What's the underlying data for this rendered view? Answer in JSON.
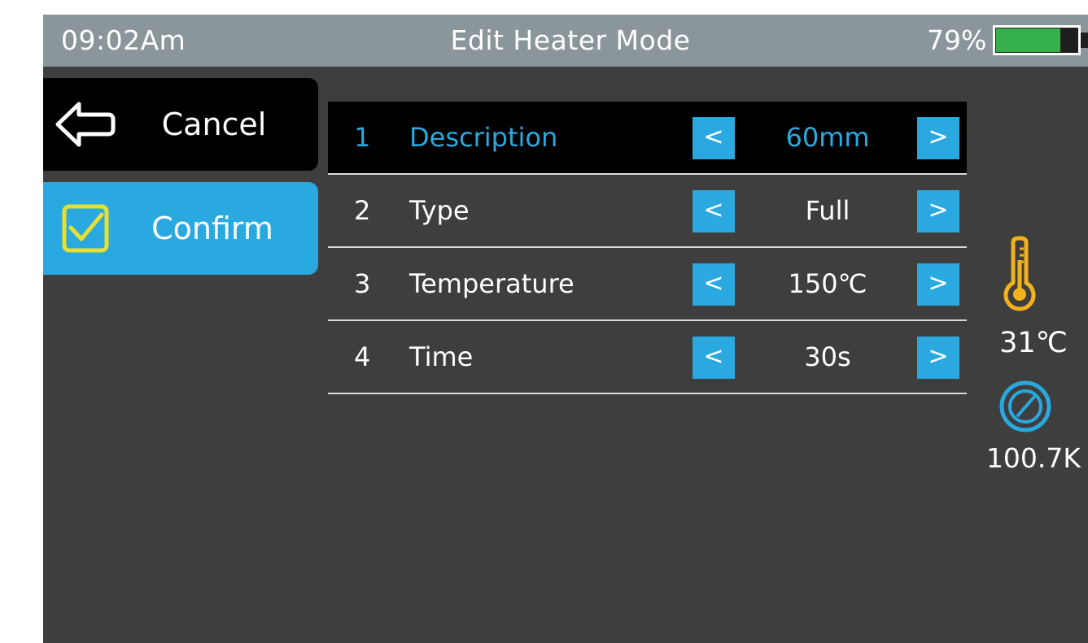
{
  "status_bar": {
    "time": "09:02Am",
    "title": "Edit Heater Mode",
    "battery_percent_label": "79%",
    "battery_level": 0.79
  },
  "actions": {
    "cancel_label": "Cancel",
    "confirm_label": "Confirm"
  },
  "settings": [
    {
      "index": "1",
      "label": "Description",
      "value": "60mm",
      "selected": true
    },
    {
      "index": "2",
      "label": "Type",
      "value": "Full",
      "selected": false
    },
    {
      "index": "3",
      "label": "Temperature",
      "value": "150℃",
      "selected": false
    },
    {
      "index": "4",
      "label": "Time",
      "value": "30s",
      "selected": false
    }
  ],
  "arrows": {
    "decrement": "<",
    "increment": ">"
  },
  "sensors": {
    "temperature": "31℃",
    "pressure": "100.7K"
  },
  "icons": {
    "cancel": "back-arrow-icon",
    "confirm": "checkbox-checked-icon",
    "temperature": "thermometer-icon",
    "pressure": "gauge-icon"
  },
  "colors": {
    "accent": "#29a9df",
    "status_bar": "#8b969b",
    "background": "#3e3e3e",
    "battery_fill": "#36b04a",
    "checkbox": "#e5e033",
    "thermometer": "#f2b21b"
  }
}
